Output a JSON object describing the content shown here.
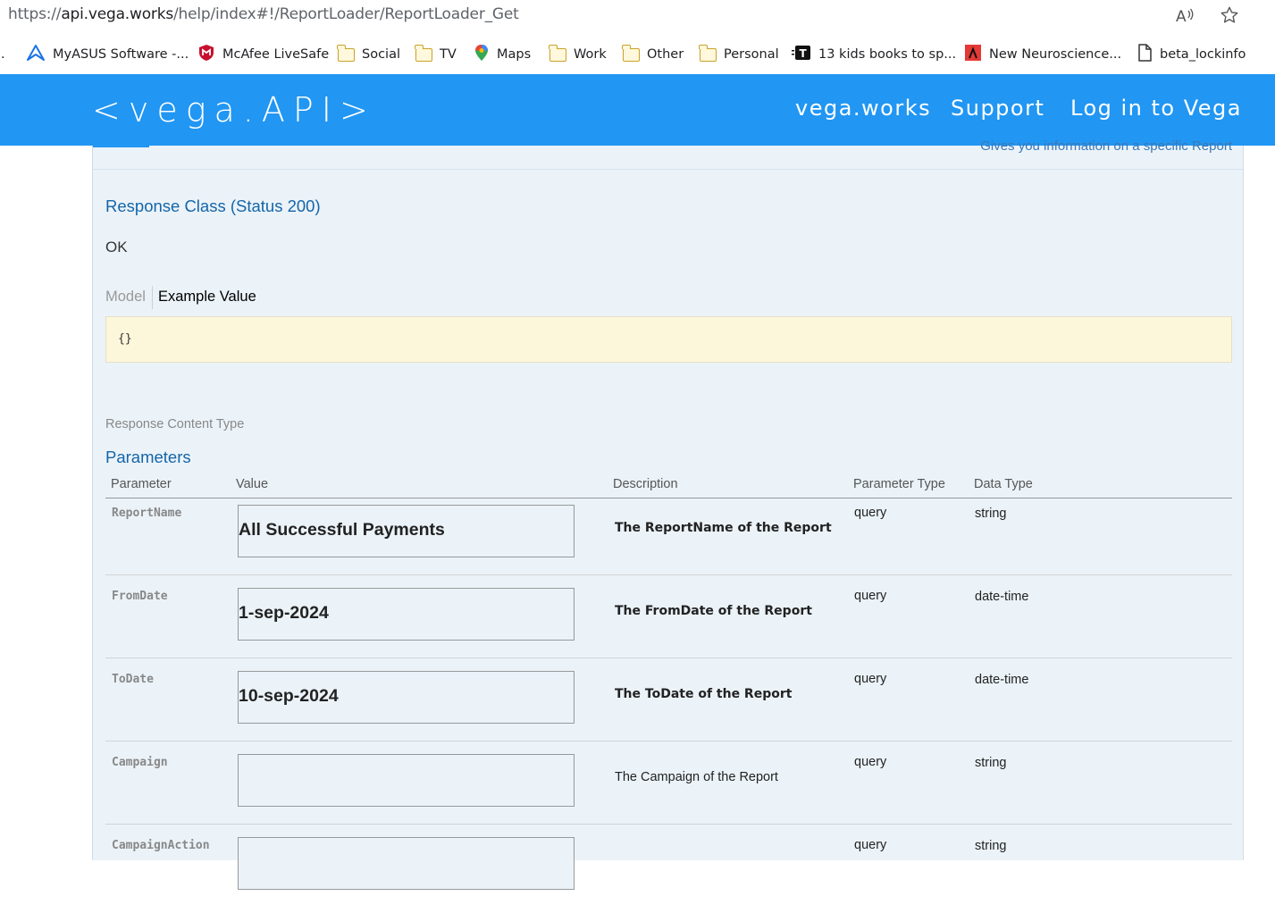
{
  "browser": {
    "url_prefix": "https://",
    "url_host": "api.vega.works",
    "url_path": "/help/index#!/ReportLoader/ReportLoader_Get",
    "read_aloud_icon": "read-aloud-icon",
    "favorite_icon": "star-icon"
  },
  "bookmarks": [
    {
      "label": "MyASUS Software -...",
      "icon": "asus-icon"
    },
    {
      "label": "McAfee LiveSafe",
      "icon": "mcafee-icon"
    },
    {
      "label": "Social",
      "icon": "folder-icon"
    },
    {
      "label": "TV",
      "icon": "folder-icon"
    },
    {
      "label": "Maps",
      "icon": "maps-pin-icon"
    },
    {
      "label": "Work",
      "icon": "folder-icon"
    },
    {
      "label": "Other",
      "icon": "folder-icon"
    },
    {
      "label": "Personal",
      "icon": "folder-icon"
    },
    {
      "label": "13 kids books to sp...",
      "icon": "t-logo-icon"
    },
    {
      "label": "New Neuroscience...",
      "icon": "article-icon"
    },
    {
      "label": "beta_lockinfo",
      "icon": "document-icon"
    }
  ],
  "header": {
    "logo": "<vega.API>",
    "nav": [
      "vega.works",
      "Support",
      "Log in to Vega"
    ],
    "color": "#2196f3"
  },
  "panel": {
    "top_note": "Gives you information on a specific Report",
    "response_class_title": "Response Class (Status 200)",
    "response_status_text": "OK",
    "model_tab": "Model",
    "example_tab": "Example Value",
    "example_code": "{}",
    "response_content_type_label": "Response Content Type",
    "parameters_title": "Parameters",
    "columns": [
      "Parameter",
      "Value",
      "Description",
      "Parameter Type",
      "Data Type"
    ],
    "rows": [
      {
        "name": "ReportName",
        "value": "All Successful Payments",
        "description": "The ReportName of the Report",
        "param_type": "query",
        "data_type": "string",
        "desc_bold": true
      },
      {
        "name": "FromDate",
        "value": "1-sep-2024",
        "description": "The FromDate of the Report",
        "param_type": "query",
        "data_type": "date-time",
        "desc_bold": true
      },
      {
        "name": "ToDate",
        "value": "10-sep-2024",
        "description": "The ToDate of the Report",
        "param_type": "query",
        "data_type": "date-time",
        "desc_bold": true
      },
      {
        "name": "Campaign",
        "value": "",
        "description": "The Campaign of the Report",
        "param_type": "query",
        "data_type": "string",
        "desc_bold": false
      },
      {
        "name": "CampaignAction",
        "value": "",
        "description": "",
        "param_type": "query",
        "data_type": "string",
        "desc_bold": false
      }
    ]
  }
}
